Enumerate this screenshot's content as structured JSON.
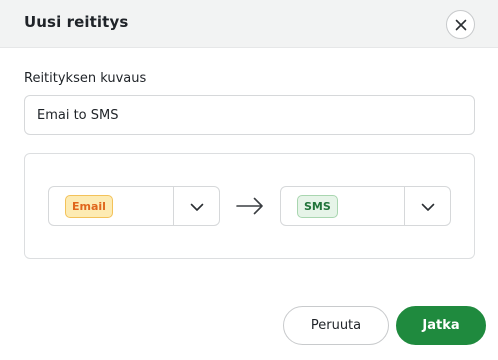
{
  "dialog": {
    "title": "Uusi reititys",
    "close_label": "×"
  },
  "form": {
    "description_label": "Reitityksen kuvaus",
    "description_value": "Emai to SMS"
  },
  "route": {
    "from": {
      "value": "Email",
      "color": "#e0661c",
      "background": "#fdebb3"
    },
    "to": {
      "value": "SMS",
      "color": "#21743a",
      "background": "#e6f4e8"
    },
    "arrow_icon": "arrow-right-icon",
    "dropdown_icon": "chevron-down-icon"
  },
  "actions": {
    "cancel_label": "Peruuta",
    "continue_label": "Jatka",
    "accent": "#1f8a3e"
  }
}
